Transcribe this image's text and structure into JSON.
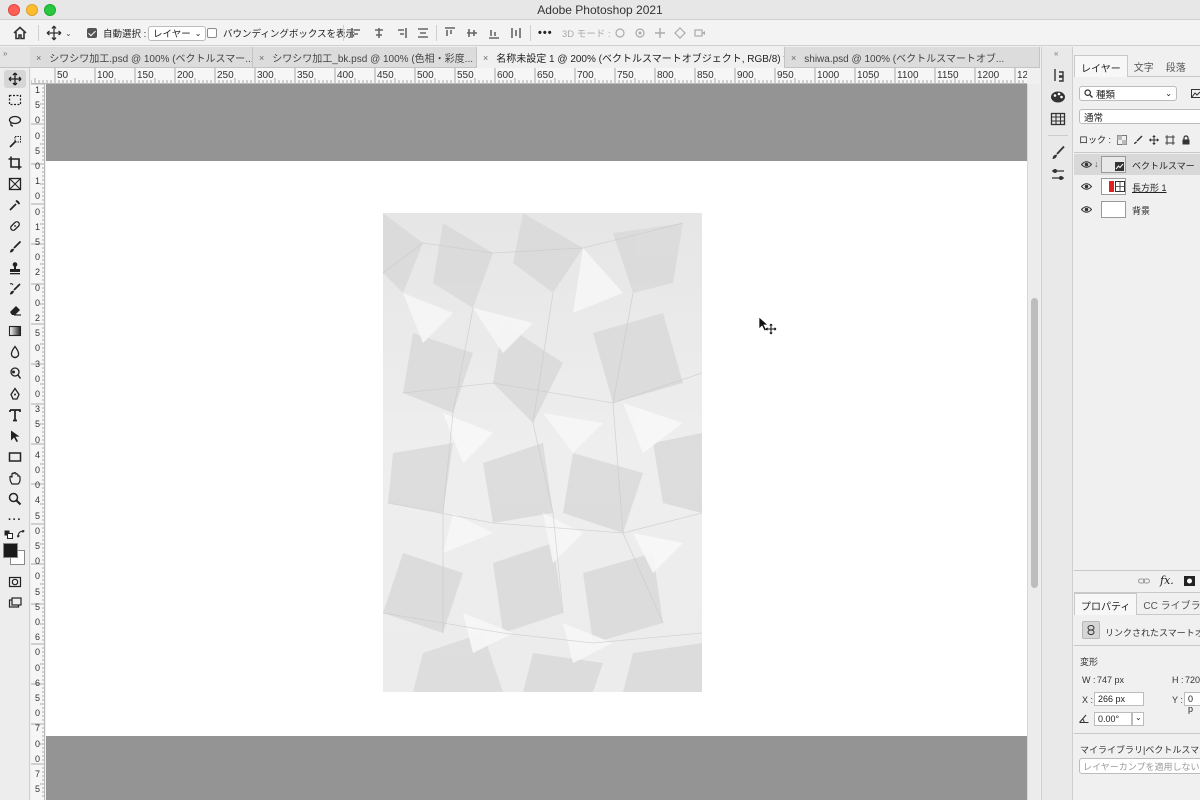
{
  "app": {
    "title": "Adobe Photoshop 2021"
  },
  "options_bar": {
    "auto_select_label": "自動選択 :",
    "auto_select_target": "レイヤー",
    "bounding_box_label": "バウンディングボックスを表示",
    "three_d_mode_label": "3D モード :",
    "more_label": "•••"
  },
  "tabs": [
    {
      "label": "シワシワ加工.psd @ 100% (ベクトルスマー...",
      "close": "×"
    },
    {
      "label": "シワシワ加工_bk.psd @ 100% (色相・彩度...",
      "close": "×"
    },
    {
      "label": "名称未設定 1 @ 200% (ベクトルスマートオブジェクト, RGB/8) *",
      "close": "×"
    },
    {
      "label": "shiwa.psd @ 100% (ベクトルスマートオブ...",
      "close": "×"
    }
  ],
  "ruler": {
    "top_labels": [
      "50",
      "100",
      "150",
      "200",
      "250",
      "300",
      "350",
      "400",
      "450",
      "500",
      "550",
      "600",
      "650",
      "700",
      "750",
      "800",
      "850",
      "900",
      "950",
      "1000",
      "1050",
      "1100",
      "1150",
      "1200",
      "12"
    ],
    "left_labels": [
      "1",
      "5",
      "0",
      "0",
      "5",
      "0",
      "1",
      "0",
      "0",
      "1",
      "5",
      "0",
      "2",
      "0",
      "0",
      "2",
      "5",
      "0",
      "3",
      "0",
      "0",
      "3",
      "5",
      "0",
      "4",
      "0",
      "0",
      "4",
      "5",
      "0",
      "5",
      "0",
      "0",
      "5",
      "5",
      "0",
      "6",
      "0",
      "0",
      "6",
      "5",
      "0",
      "7",
      "0",
      "0",
      "7",
      "5"
    ]
  },
  "layers_panel": {
    "tabs": [
      "レイヤー",
      "文字",
      "段落"
    ],
    "filter_kind": "種類",
    "blend_mode": "通常",
    "lock_label": "ロック :",
    "layers": [
      {
        "name": "ベクトルスマー",
        "active": true
      },
      {
        "name": "長方形 1",
        "active": false
      },
      {
        "name": "背景",
        "active": false
      }
    ],
    "footer_fx": "fx."
  },
  "properties_panel": {
    "tabs": [
      "プロパティ",
      "CC ライブラリ"
    ],
    "linked_smart_object": "リンクされたスマートオブ",
    "transform_label": "変形",
    "w_label": "W :",
    "w_value": "747 px",
    "h_label": "H :",
    "h_value": "720",
    "x_label": "X :",
    "x_value": "266 px",
    "y_label": "Y :",
    "y_value": "0 p",
    "angle_value": "0.00°",
    "library_label": "マイライブラリ|ベクトルスマー",
    "layer_comp_placeholder": "レイヤーカンプを適用しない"
  },
  "colors": {
    "canvas_bg": "#949494",
    "foreground": "#1a1a1a",
    "background": "#ffffff",
    "rect_layer_red": "#e02020"
  }
}
